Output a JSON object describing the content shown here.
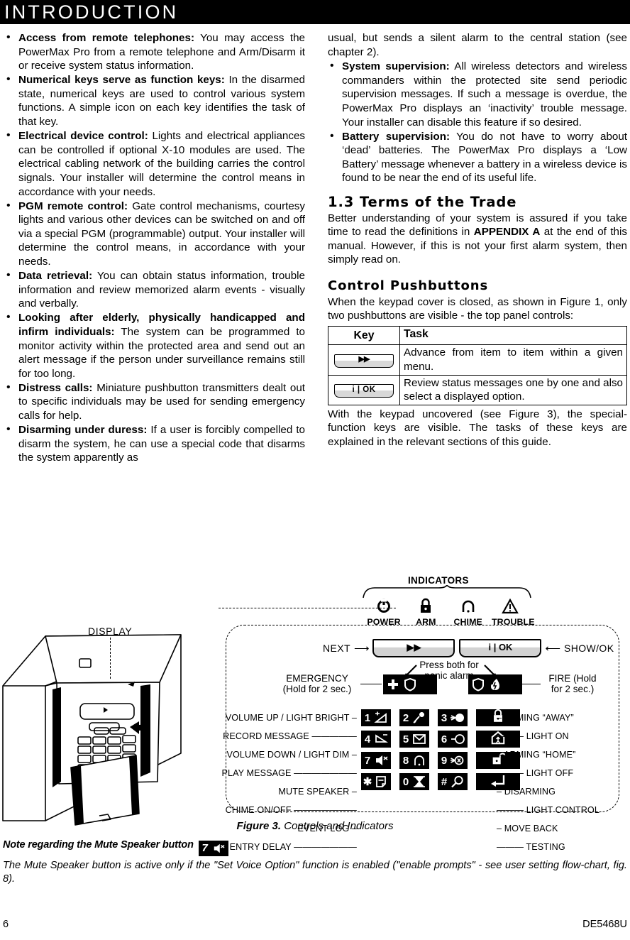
{
  "header": {
    "title": "INTRODUCTION"
  },
  "left_column": {
    "bullets": [
      {
        "lead": "Access from remote telephones:",
        "text": " You may access the PowerMax Pro from a remote telephone and Arm/Disarm it or receive system status information."
      },
      {
        "lead": "Numerical keys serve as function keys:",
        "text": " In the disarmed state, numerical keys are used to control various system functions. A simple icon on each key identifies the task of that key."
      },
      {
        "lead": "Electrical device control:",
        "text": " Lights and electrical appliances can be controlled if optional X-10 modules are used. The electrical cabling network of the building carries the control signals. Your installer will determine the control means in accordance with your needs."
      },
      {
        "lead": "PGM remote control:",
        "text": " Gate control mechanisms, courtesy lights and various other devices can be switched on and off via a special PGM (programmable) output. Your installer will determine the control means, in accordance with your needs."
      },
      {
        "lead": "Data retrieval:",
        "text": " You can obtain status information, trouble information and review memorized alarm events - visually and verbally."
      },
      {
        "lead": "Looking after elderly, physically handicapped and infirm individuals:",
        "text": "  The system can be programmed to monitor activity within the protected area and send out an alert message if the person under surveillance remains still for too long."
      },
      {
        "lead": "Distress calls:",
        "text": " Miniature pushbutton transmitters dealt out to specific individuals may be used for sending emergency calls for help."
      },
      {
        "lead": "Disarming under duress:",
        "text": " If a user is forcibly compelled to disarm the system, he can use a special code that disarms the system apparently as"
      }
    ]
  },
  "right_column": {
    "continuation": "usual, but sends a silent alarm to the central station (see chapter 2).",
    "bullets": [
      {
        "lead": "System supervision:",
        "text": " All wireless detectors and wireless commanders within the protected site send periodic supervision messages. If such a message is overdue, the PowerMax Pro displays an ‘inactivity’ trouble message. Your installer can disable this feature if so desired."
      },
      {
        "lead": "Battery supervision:",
        "text": " You do not have to worry about ‘dead’ batteries. The PowerMax Pro displays a ‘Low Battery’ message whenever a battery in a wireless device is found to be near the end of its useful life."
      }
    ],
    "section_heading": "1.3 Terms of the Trade",
    "section_text_1": "Better understanding of your system is assured if you take time to read the definitions in ",
    "section_text_bold": "APPENDIX A",
    "section_text_2": " at the end of this manual. However, if this is not your first alarm system, then simply read on.",
    "sub_heading": "Control Pushbuttons",
    "sub_text": "When the keypad cover is closed, as shown in Figure 1, only two pushbuttons are visible - the top panel controls:",
    "table": {
      "columns": [
        "Key",
        "Task"
      ],
      "rows": [
        {
          "key_glyph": "▶▶",
          "key_type": "next-button",
          "task": "Advance from item to item within a given menu."
        },
        {
          "key_glyph": "i | OK",
          "key_type": "show-ok-button",
          "task": "Review status messages one by one and also select a displayed option."
        }
      ]
    },
    "after_table_text": "With the keypad uncovered (see Figure 3), the special-function keys are visible. The tasks of these keys are explained in the relevant sections of this guide."
  },
  "figure": {
    "caption_bold": "Figure 3.",
    "caption_rest": " Controls and Indicators",
    "display_label": "DISPLAY",
    "indicators_title": "INDICATORS",
    "indicators": [
      {
        "label": "POWER",
        "icon": "power-icon"
      },
      {
        "label": "ARM",
        "icon": "padlock-closed-icon"
      },
      {
        "label": "CHIME",
        "icon": "bell-icon"
      },
      {
        "label": "TROUBLE",
        "icon": "warning-triangle-icon"
      }
    ],
    "next_label": "NEXT",
    "next_button_glyph": "▶▶",
    "showok_label": "SHOW/OK",
    "showok_button_glyph": "i | OK",
    "press_both_text": "Press both for panic alarm",
    "emergency_label": "EMERGENCY",
    "emergency_sub": "(Hold for 2 sec.)",
    "fire_label": "FIRE (Hold",
    "fire_sub": "for 2 sec.)",
    "keypad_rows": [
      {
        "left_primary": "VOLUME UP / LIGHT BRIGHT",
        "left_secondary": "RECORD MESSAGE",
        "keys": [
          {
            "num": "1",
            "icon": "volume-up-icon"
          },
          {
            "num": "2",
            "icon": "microphone-icon"
          },
          {
            "num": "3",
            "icon": "lamp-on-icon"
          }
        ],
        "wide_key_icon": "padlock-closed-icon",
        "right_primary": "ARMING “AWAY”",
        "right_secondary": "LIGHT ON"
      },
      {
        "left_primary": "VOLUME DOWN / LIGHT DIM",
        "left_secondary": "PLAY MESSAGE",
        "keys": [
          {
            "num": "4",
            "icon": "volume-down-icon"
          },
          {
            "num": "5",
            "icon": "envelope-icon"
          },
          {
            "num": "6",
            "icon": "lamp-off-icon"
          }
        ],
        "wide_key_icon": "home-person-icon",
        "right_primary": "ARMING “HOME”",
        "right_secondary": "LIGHT OFF"
      },
      {
        "left_primary": "MUTE SPEAKER",
        "left_secondary": "CHIME ON/OFF",
        "keys": [
          {
            "num": "7",
            "icon": "speaker-mute-icon"
          },
          {
            "num": "8",
            "icon": "bell-icon"
          },
          {
            "num": "9",
            "icon": "lamp-control-icon"
          }
        ],
        "wide_key_icon": "padlock-open-icon",
        "right_primary": "DISARMING",
        "right_secondary": "LIGHT CONTROL"
      },
      {
        "left_primary": "EVENT LOG",
        "left_secondary": "NO ENTRY DELAY",
        "keys": [
          {
            "num": "✱",
            "icon": "log-page-icon"
          },
          {
            "num": "0",
            "icon": "hourglass-icon"
          },
          {
            "num": "#",
            "icon": "magnifier-icon"
          }
        ],
        "wide_key_icon": "back-arrow-icon",
        "right_primary": "MOVE BACK",
        "right_secondary": "TESTING"
      }
    ]
  },
  "note": {
    "title": "Note regarding the Mute Speaker button",
    "title_key_num": "7",
    "title_key_icon": "speaker-mute-icon",
    "body": "The Mute Speaker button is active only if the \"Set Voice Option\" function is enabled (\"enable prompts\" - see user setting flow-chart, fig. 8)."
  },
  "footer": {
    "page_number": "6",
    "document_id": "DE5468U"
  }
}
